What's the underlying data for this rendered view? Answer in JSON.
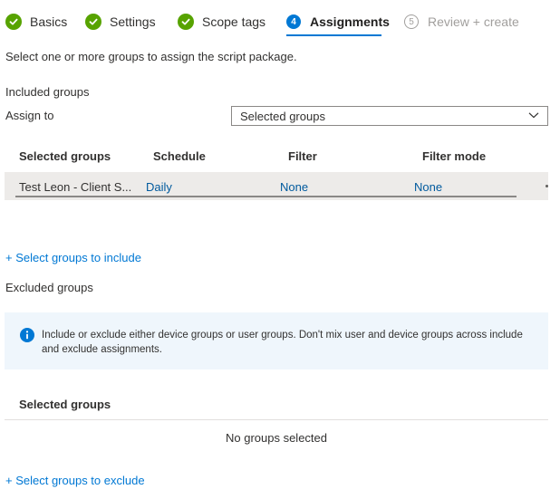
{
  "wizard": {
    "steps": [
      {
        "label": "Basics",
        "state": "done"
      },
      {
        "label": "Settings",
        "state": "done"
      },
      {
        "label": "Scope tags",
        "state": "done"
      },
      {
        "label": "Assignments",
        "number": "4",
        "state": "current"
      },
      {
        "label": "Review + create",
        "number": "5",
        "state": "future"
      }
    ]
  },
  "intro_text": "Select one or more groups to assign the script package.",
  "included": {
    "heading": "Included groups",
    "assign_to_label": "Assign to",
    "assign_to_value": "Selected groups",
    "columns": [
      "Selected groups",
      "Schedule",
      "Filter",
      "Filter mode"
    ],
    "rows": [
      {
        "group": "Test Leon - Client S...",
        "schedule": "Daily",
        "filter": "None",
        "filter_mode": "None"
      }
    ],
    "add_link": "+ Select groups to include"
  },
  "excluded": {
    "heading": "Excluded groups",
    "info_message": "Include or exclude either device groups or user groups. Don't mix user and device groups across include and exclude assignments.",
    "column": "Selected groups",
    "empty_text": "No groups selected",
    "add_link": "+ Select groups to exclude"
  },
  "colors": {
    "accent": "#0078d4",
    "success": "#57a300",
    "row_selected": "#edebe9",
    "info_bg": "#eff6fc"
  },
  "icons": {
    "done_step": "checkmark-circle-icon",
    "dropdown": "chevron-down-icon",
    "info": "info-icon"
  }
}
